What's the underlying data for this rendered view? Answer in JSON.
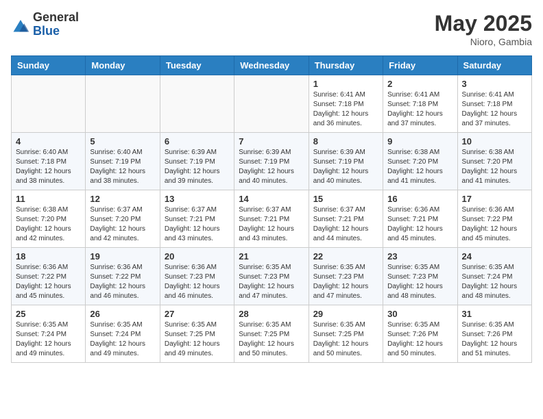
{
  "header": {
    "logo_general": "General",
    "logo_blue": "Blue",
    "month_year": "May 2025",
    "location": "Nioro, Gambia"
  },
  "weekdays": [
    "Sunday",
    "Monday",
    "Tuesday",
    "Wednesday",
    "Thursday",
    "Friday",
    "Saturday"
  ],
  "weeks": [
    [
      {
        "day": "",
        "info": ""
      },
      {
        "day": "",
        "info": ""
      },
      {
        "day": "",
        "info": ""
      },
      {
        "day": "",
        "info": ""
      },
      {
        "day": "1",
        "info": "Sunrise: 6:41 AM\nSunset: 7:18 PM\nDaylight: 12 hours\nand 36 minutes."
      },
      {
        "day": "2",
        "info": "Sunrise: 6:41 AM\nSunset: 7:18 PM\nDaylight: 12 hours\nand 37 minutes."
      },
      {
        "day": "3",
        "info": "Sunrise: 6:41 AM\nSunset: 7:18 PM\nDaylight: 12 hours\nand 37 minutes."
      }
    ],
    [
      {
        "day": "4",
        "info": "Sunrise: 6:40 AM\nSunset: 7:18 PM\nDaylight: 12 hours\nand 38 minutes."
      },
      {
        "day": "5",
        "info": "Sunrise: 6:40 AM\nSunset: 7:19 PM\nDaylight: 12 hours\nand 38 minutes."
      },
      {
        "day": "6",
        "info": "Sunrise: 6:39 AM\nSunset: 7:19 PM\nDaylight: 12 hours\nand 39 minutes."
      },
      {
        "day": "7",
        "info": "Sunrise: 6:39 AM\nSunset: 7:19 PM\nDaylight: 12 hours\nand 40 minutes."
      },
      {
        "day": "8",
        "info": "Sunrise: 6:39 AM\nSunset: 7:19 PM\nDaylight: 12 hours\nand 40 minutes."
      },
      {
        "day": "9",
        "info": "Sunrise: 6:38 AM\nSunset: 7:20 PM\nDaylight: 12 hours\nand 41 minutes."
      },
      {
        "day": "10",
        "info": "Sunrise: 6:38 AM\nSunset: 7:20 PM\nDaylight: 12 hours\nand 41 minutes."
      }
    ],
    [
      {
        "day": "11",
        "info": "Sunrise: 6:38 AM\nSunset: 7:20 PM\nDaylight: 12 hours\nand 42 minutes."
      },
      {
        "day": "12",
        "info": "Sunrise: 6:37 AM\nSunset: 7:20 PM\nDaylight: 12 hours\nand 42 minutes."
      },
      {
        "day": "13",
        "info": "Sunrise: 6:37 AM\nSunset: 7:21 PM\nDaylight: 12 hours\nand 43 minutes."
      },
      {
        "day": "14",
        "info": "Sunrise: 6:37 AM\nSunset: 7:21 PM\nDaylight: 12 hours\nand 43 minutes."
      },
      {
        "day": "15",
        "info": "Sunrise: 6:37 AM\nSunset: 7:21 PM\nDaylight: 12 hours\nand 44 minutes."
      },
      {
        "day": "16",
        "info": "Sunrise: 6:36 AM\nSunset: 7:21 PM\nDaylight: 12 hours\nand 45 minutes."
      },
      {
        "day": "17",
        "info": "Sunrise: 6:36 AM\nSunset: 7:22 PM\nDaylight: 12 hours\nand 45 minutes."
      }
    ],
    [
      {
        "day": "18",
        "info": "Sunrise: 6:36 AM\nSunset: 7:22 PM\nDaylight: 12 hours\nand 45 minutes."
      },
      {
        "day": "19",
        "info": "Sunrise: 6:36 AM\nSunset: 7:22 PM\nDaylight: 12 hours\nand 46 minutes."
      },
      {
        "day": "20",
        "info": "Sunrise: 6:36 AM\nSunset: 7:23 PM\nDaylight: 12 hours\nand 46 minutes."
      },
      {
        "day": "21",
        "info": "Sunrise: 6:35 AM\nSunset: 7:23 PM\nDaylight: 12 hours\nand 47 minutes."
      },
      {
        "day": "22",
        "info": "Sunrise: 6:35 AM\nSunset: 7:23 PM\nDaylight: 12 hours\nand 47 minutes."
      },
      {
        "day": "23",
        "info": "Sunrise: 6:35 AM\nSunset: 7:23 PM\nDaylight: 12 hours\nand 48 minutes."
      },
      {
        "day": "24",
        "info": "Sunrise: 6:35 AM\nSunset: 7:24 PM\nDaylight: 12 hours\nand 48 minutes."
      }
    ],
    [
      {
        "day": "25",
        "info": "Sunrise: 6:35 AM\nSunset: 7:24 PM\nDaylight: 12 hours\nand 49 minutes."
      },
      {
        "day": "26",
        "info": "Sunrise: 6:35 AM\nSunset: 7:24 PM\nDaylight: 12 hours\nand 49 minutes."
      },
      {
        "day": "27",
        "info": "Sunrise: 6:35 AM\nSunset: 7:25 PM\nDaylight: 12 hours\nand 49 minutes."
      },
      {
        "day": "28",
        "info": "Sunrise: 6:35 AM\nSunset: 7:25 PM\nDaylight: 12 hours\nand 50 minutes."
      },
      {
        "day": "29",
        "info": "Sunrise: 6:35 AM\nSunset: 7:25 PM\nDaylight: 12 hours\nand 50 minutes."
      },
      {
        "day": "30",
        "info": "Sunrise: 6:35 AM\nSunset: 7:26 PM\nDaylight: 12 hours\nand 50 minutes."
      },
      {
        "day": "31",
        "info": "Sunrise: 6:35 AM\nSunset: 7:26 PM\nDaylight: 12 hours\nand 51 minutes."
      }
    ]
  ]
}
